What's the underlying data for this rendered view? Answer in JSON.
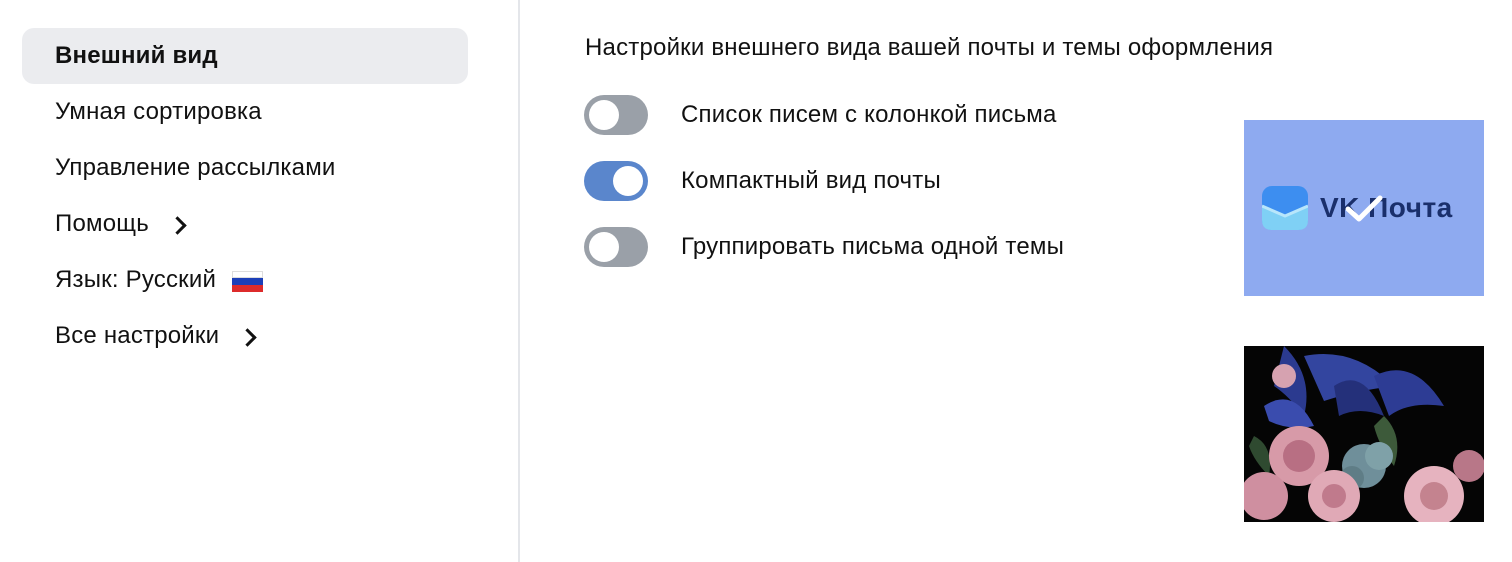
{
  "sidebar": {
    "items": [
      {
        "label": "Внешний вид"
      },
      {
        "label": "Умная сортировка"
      },
      {
        "label": "Управление рассылками"
      },
      {
        "label": "Помощь"
      },
      {
        "label": "Язык: Русский"
      },
      {
        "label": "Все настройки"
      }
    ]
  },
  "main": {
    "heading": "Настройки внешнего вида вашей почты и темы оформления",
    "settings": [
      {
        "label": "Список писем с колонкой письма",
        "enabled": false
      },
      {
        "label": "Компактный вид почты",
        "enabled": true
      },
      {
        "label": "Группировать письма одной темы",
        "enabled": false
      }
    ],
    "themes": [
      {
        "name": "vk-mail-theme",
        "logo_text": "VK Почта",
        "selected": true,
        "color": "#8eaaf0"
      },
      {
        "name": "dark-floral-theme",
        "selected": false,
        "color": "#050505"
      }
    ]
  },
  "colors": {
    "toggle_on": "#5a86cc",
    "toggle_off": "#9aa0a8",
    "active_nav_bg": "#ebecef"
  }
}
